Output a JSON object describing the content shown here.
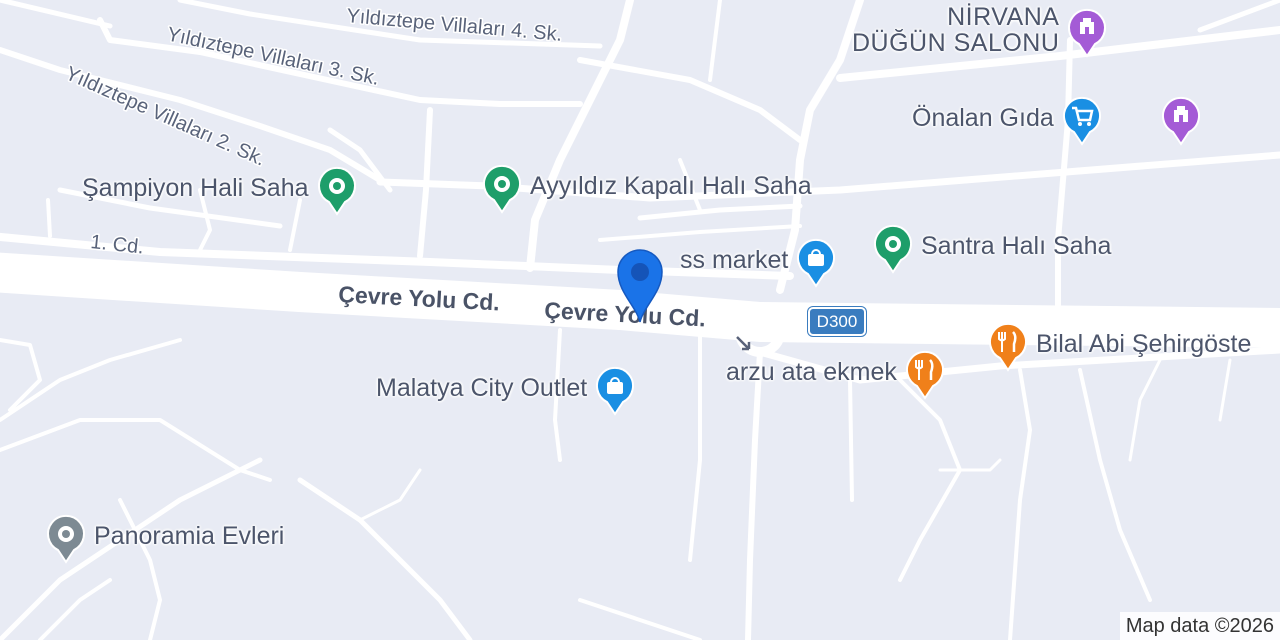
{
  "map": {
    "street_labels": {
      "yildiztepe_4": "Yıldıztepe Villaları 4. Sk.",
      "yildiztepe_3": "Yıldıztepe Villaları 3. Sk.",
      "yildiztepe_2": "Yıldıztepe Villaları 2. Sk.",
      "cd_1": "1. Cd.",
      "cevre_yolu_a": "Çevre Yolu Cd.",
      "cevre_yolu_b": "Çevre Yolu Cd."
    },
    "route_shield": "D300",
    "pois": {
      "nirvana_line1": "NİRVANA",
      "nirvana_line2": "DÜĞÜN SALONU",
      "onalan": "Önalan Gıda",
      "sampiyon": "Şampiyon Hali Saha",
      "ayyildiz": "Ayyıldız Kapalı Halı Saha",
      "santra": "Santra Halı Saha",
      "market": "ss market",
      "malatya": "Malatya City Outlet",
      "arzu": "arzu ata ekmek",
      "bilal": "Bilal Abi Şehirgöste",
      "panoramia": "Panoramia Evleri"
    },
    "colors": {
      "background": "#e8ebf4",
      "road": "#ffffff",
      "sports_pin": "#1e9e6a",
      "shopping_pin": "#1a8fe3",
      "food_pin": "#f0801a",
      "venue_pin": "#a45bd6",
      "place_pin": "#7d8a93",
      "location_marker": "#1a73e8"
    },
    "icons": {
      "sports": "circle-dot-icon",
      "shopping": "shopping-bag-icon",
      "cart": "shopping-cart-icon",
      "food": "fork-knife-icon",
      "venue": "building-icon"
    },
    "attribution": "Map data ©2026"
  }
}
